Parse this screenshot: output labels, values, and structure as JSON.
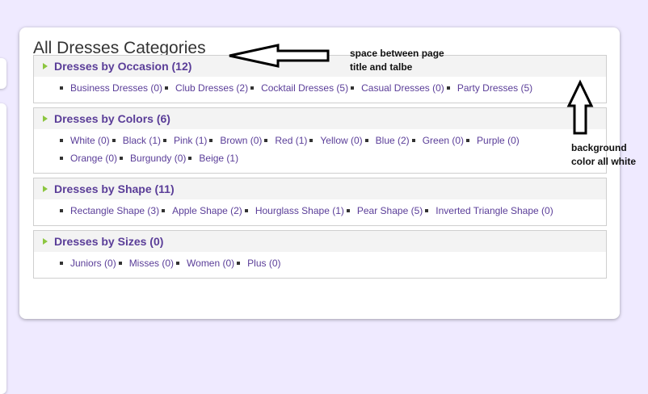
{
  "page_title": "All Dresses Categories",
  "categories": [
    {
      "title": "Dresses by Occasion (12)",
      "items": [
        "Business Dresses (0)",
        "Club Dresses (2)",
        "Cocktail Dresses (5)",
        "Casual Dresses (0)",
        "Party Dresses (5)"
      ]
    },
    {
      "title": "Dresses by Colors (6)",
      "items": [
        "White (0)",
        "Black (1)",
        "Pink (1)",
        "Brown (0)",
        "Red (1)",
        "Yellow (0)",
        "Blue (2)",
        "Green (0)",
        "Purple (0)",
        "Orange (0)",
        "Burgundy (0)",
        "Beige (1)"
      ]
    },
    {
      "title": "Dresses by Shape (11)",
      "items": [
        "Rectangle Shape (3)",
        "Apple Shape (2)",
        "Hourglass Shape (1)",
        "Pear Shape (5)",
        "Inverted Triangle Shape (0)"
      ]
    },
    {
      "title": "Dresses by Sizes (0)",
      "items": [
        "Juniors (0)",
        "Misses (0)",
        "Women (0)",
        "Plus (0)"
      ]
    }
  ],
  "annotations": {
    "spacing_note": "space between page\ntitle and talbe",
    "background_note": "background\ncolor all white"
  },
  "colors": {
    "page_background": "#efeaff",
    "link": "#5a3d98",
    "arrow_bullet": "#8cc63f",
    "header_background": "#f3f3f3"
  }
}
